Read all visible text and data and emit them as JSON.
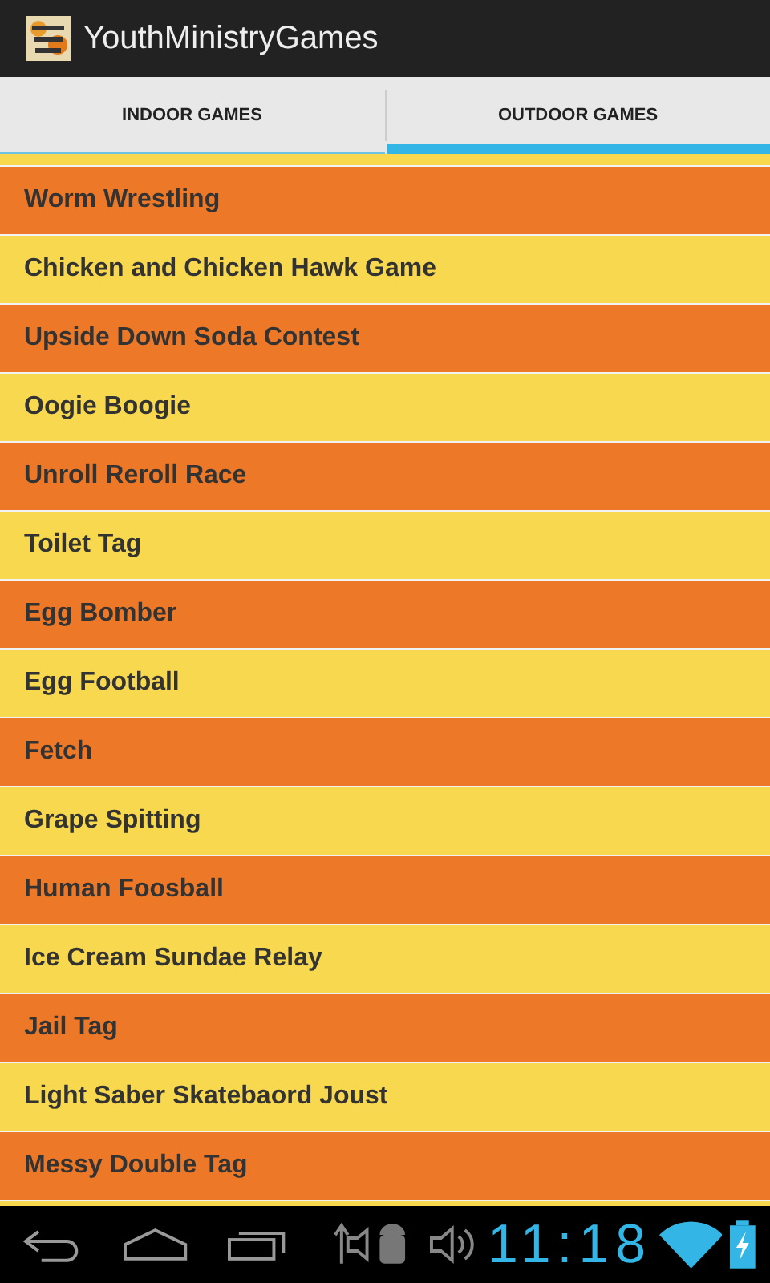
{
  "action_bar": {
    "title": "YouthMinistryGames"
  },
  "tabs": [
    {
      "label": "INDOOR GAMES",
      "selected": false
    },
    {
      "label": "OUTDOOR GAMES",
      "selected": true
    }
  ],
  "list": {
    "top_partial_row": {
      "color": "#f8d84e"
    },
    "items": [
      {
        "label": "Worm Wrestling",
        "color": "#ec7828"
      },
      {
        "label": "Chicken and Chicken Hawk Game",
        "color": "#f8d84e"
      },
      {
        "label": "Upside Down Soda Contest",
        "color": "#ec7828"
      },
      {
        "label": "Oogie Boogie",
        "color": "#f8d84e"
      },
      {
        "label": "Unroll Reroll Race",
        "color": "#ec7828"
      },
      {
        "label": "Toilet Tag",
        "color": "#f8d84e"
      },
      {
        "label": "Egg Bomber",
        "color": "#ec7828"
      },
      {
        "label": "Egg Football",
        "color": "#f8d84e"
      },
      {
        "label": "Fetch",
        "color": "#ec7828"
      },
      {
        "label": "Grape Spitting",
        "color": "#f8d84e"
      },
      {
        "label": "Human Foosball",
        "color": "#ec7828"
      },
      {
        "label": "Ice Cream Sundae Relay",
        "color": "#f8d84e"
      },
      {
        "label": "Jail Tag",
        "color": "#ec7828"
      },
      {
        "label": "Light Saber Skatebaord Joust",
        "color": "#f8d84e"
      },
      {
        "label": "Messy Double Tag",
        "color": "#ec7828"
      }
    ],
    "bottom_partial_row": {
      "color": "#f8d84e"
    }
  },
  "system_bar": {
    "time": "11:18"
  }
}
